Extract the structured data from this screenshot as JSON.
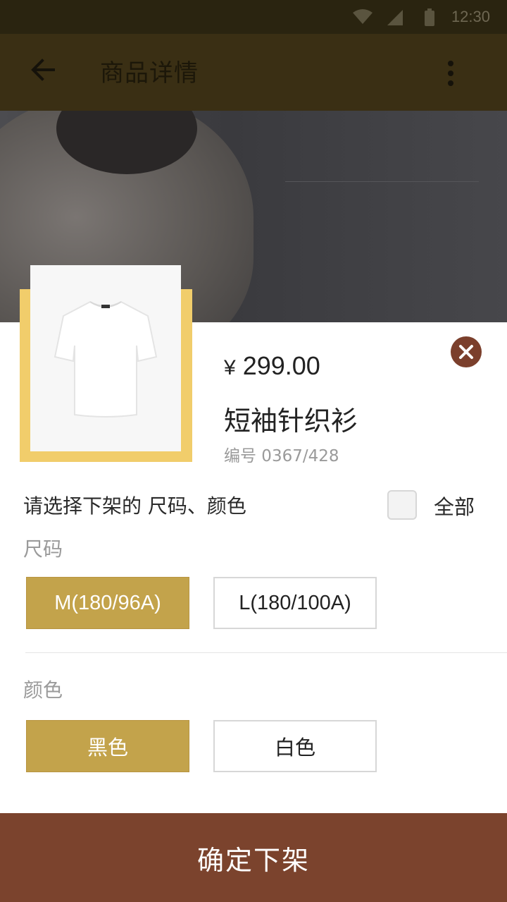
{
  "status_bar": {
    "time": "12:30"
  },
  "app_bar": {
    "title": "商品详情"
  },
  "product": {
    "price_symbol": "¥",
    "price": "299.00",
    "name": "短袖针织衫",
    "code": "编号 0367/428"
  },
  "selection": {
    "prompt": "请选择下架的 尺码、颜色",
    "all_label": "全部",
    "size_label": "尺码",
    "sizes": [
      {
        "label": "M(180/96A)",
        "selected": true
      },
      {
        "label": "L(180/100A)",
        "selected": false
      }
    ],
    "color_label": "颜色",
    "colors": [
      {
        "label": "黑色",
        "selected": true
      },
      {
        "label": "白色",
        "selected": false
      }
    ]
  },
  "confirm_label": "确定下架",
  "colors": {
    "accent": "#c3a34b",
    "brand": "#7b432d",
    "highlight_frame": "#f1cd6b"
  },
  "icons": {
    "back": "arrow-left-icon",
    "more": "more-vertical-icon",
    "close": "close-icon",
    "wifi": "wifi-icon",
    "signal": "signal-icon",
    "battery": "battery-icon"
  }
}
